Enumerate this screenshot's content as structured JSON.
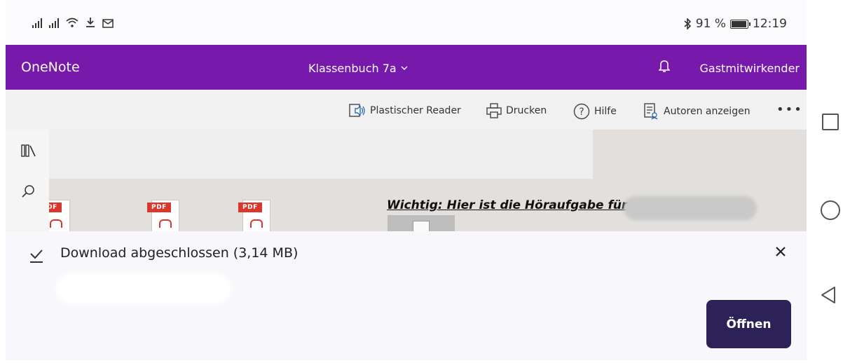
{
  "status_bar": {
    "battery": "91 %",
    "time": "12:19",
    "icons": [
      "signal-icon",
      "signal-icon",
      "wifi-icon",
      "download-icon",
      "mail-icon",
      "bluetooth-icon",
      "battery-icon"
    ]
  },
  "header": {
    "app_name": "OneNote",
    "notebook": "Klassenbuch 7a",
    "user": "Gastmitwirkender",
    "background": "#7719aa"
  },
  "toolbar": {
    "reader": "Plastischer Reader",
    "print": "Drucken",
    "help": "Hilfe",
    "authors": "Autoren anzeigen",
    "more": "•••"
  },
  "page": {
    "pdf_tag": "PDF",
    "notice": "Wichtig: Hier ist die Höraufgabe für"
  },
  "download": {
    "title": "Download abgeschlossen (3,14 MB)",
    "open_button": "Öffnen",
    "accent": "#2c2258"
  }
}
